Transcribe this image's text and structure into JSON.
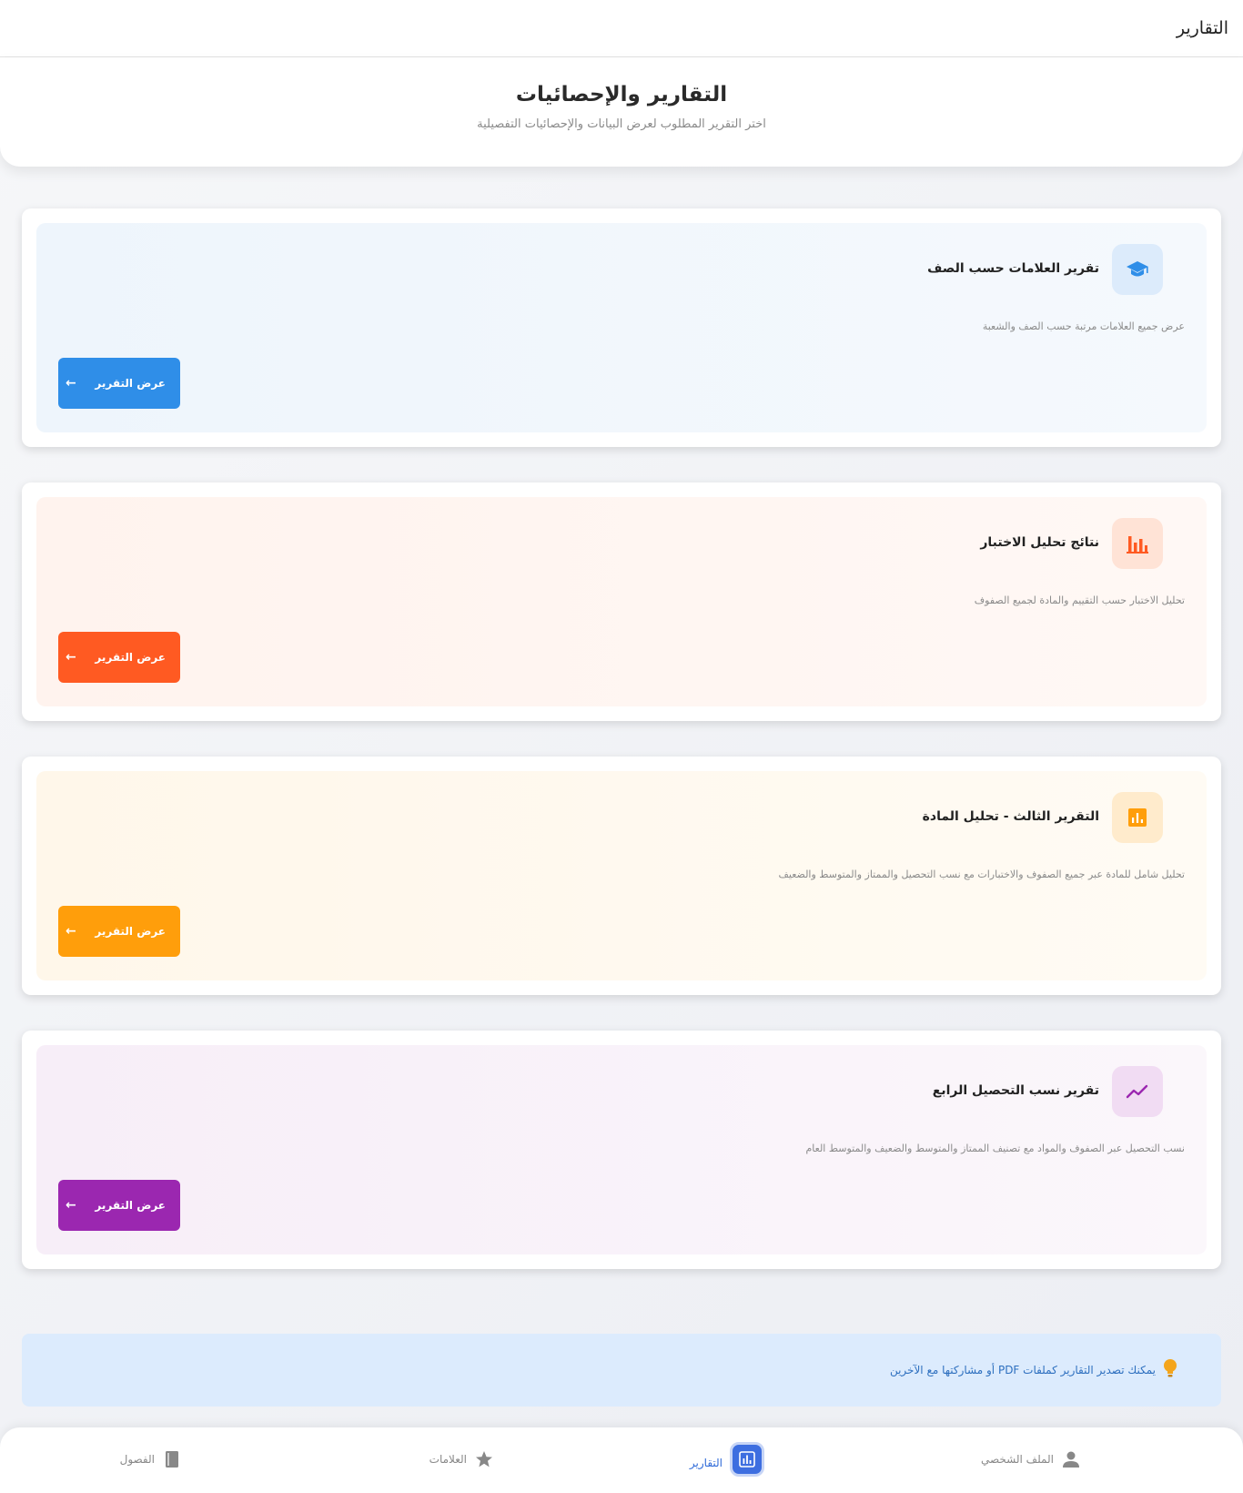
{
  "appbar": {
    "title": "التقارير"
  },
  "header": {
    "title": "التقارير والإحصائيات",
    "subtitle": "اختر التقرير المطلوب لعرض البيانات والإحصائيات التفصيلية"
  },
  "reports": [
    {
      "title": "تقرير العلامات حسب الصف",
      "description": "عرض جميع العلامات مرتبة حسب الصف والشعبة",
      "button_label": "عرض التقرير",
      "icon": "graduation-cap-icon",
      "accent": "#2f8ee8"
    },
    {
      "title": "نتائج تحليل الاختبار",
      "description": "تحليل الاختبار حسب التقييم والمادة لجميع الصفوف",
      "button_label": "عرض التقرير",
      "icon": "bar-chart-icon",
      "accent": "#ff5a22"
    },
    {
      "title": "التقرير الثالث - تحليل المادة",
      "description": "تحليل شامل للمادة عبر جميع الصفوف والاختبارات مع نسب التحصيل والممتاز والمتوسط والضعيف",
      "button_label": "عرض التقرير",
      "icon": "analytics-icon",
      "accent": "#ff9e0b"
    },
    {
      "title": "تقرير نسب التحصيل الرابع",
      "description": "نسب التحصيل عبر الصفوف والمواد مع تصنيف الممتاز والمتوسط والضعيف والمتوسط العام",
      "button_label": "عرض التقرير",
      "icon": "trending-up-icon",
      "accent": "#9b27b0"
    }
  ],
  "tip": {
    "icon": "lightbulb-icon",
    "text": "يمكنك تصدير التقارير كملفات PDF أو مشاركتها مع الآخرين"
  },
  "bottom_nav": [
    {
      "label": "الملف الشخصي",
      "icon": "person-icon",
      "active": false
    },
    {
      "label": "التقارير",
      "icon": "analytics-icon",
      "active": true
    },
    {
      "label": "العلامات",
      "icon": "star-icon",
      "active": false
    },
    {
      "label": "الفصول",
      "icon": "book-icon",
      "active": false
    }
  ],
  "colors": {
    "blue_accent": "#2f8ee8",
    "orange_red_accent": "#ff5a22",
    "orange_accent": "#ff9e0b",
    "purple_accent": "#9b27b0",
    "nav_active": "#3d6ee0"
  }
}
